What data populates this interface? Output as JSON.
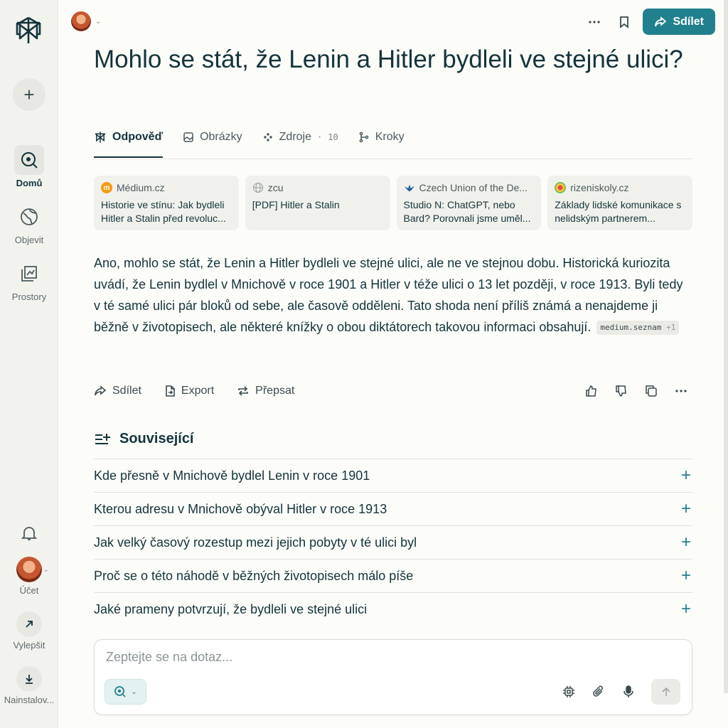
{
  "sidebar": {
    "new_thread": "+",
    "items": [
      {
        "label": "Domů",
        "icon": "search-icon",
        "active": true
      },
      {
        "label": "Objevit",
        "icon": "globe-icon",
        "active": false
      },
      {
        "label": "Prostory",
        "icon": "spaces-icon",
        "active": false
      }
    ],
    "account_label": "Účet",
    "upgrade_label": "Vylepšit",
    "install_label": "Nainstalov..."
  },
  "topbar": {
    "share_label": "Sdílet"
  },
  "page": {
    "title": "Mohlo se stát, že Lenin a Hitler bydleli ve stejné ulici?"
  },
  "tabs": [
    {
      "label": "Odpověď",
      "icon": "answer-icon",
      "active": true
    },
    {
      "label": "Obrázky",
      "icon": "image-icon",
      "active": false
    },
    {
      "label": "Zdroje",
      "icon": "sources-icon",
      "active": false,
      "count_sep": "·",
      "count": "10"
    },
    {
      "label": "Kroky",
      "icon": "steps-icon",
      "active": false
    }
  ],
  "sources": [
    {
      "site": "Médium.cz",
      "title": "Historie ve stínu: Jak bydleli Hitler a Stalin před revoluc...",
      "favicon_letter": "m",
      "favicon_color": "#f39c12"
    },
    {
      "site": "zcu",
      "title": "[PDF] Hitler a Stalin",
      "favicon_letter": "",
      "favicon_color": "#d7d7d2"
    },
    {
      "site": "Czech Union of the De...",
      "title": "Studio N: ChatGPT, nebo Bard? Porovnali jsme uměl...",
      "favicon_letter": "",
      "favicon_color": "#1f5fa8"
    },
    {
      "site": "rizeniskoly.cz",
      "title": "Základy lidské komunikace s nelidským partnerem...",
      "favicon_letter": "",
      "favicon_color": "#8fc14a"
    }
  ],
  "answer": {
    "text": "Ano, mohlo se stát, že Lenin a Hitler bydleli ve stejné ulici, ale ne ve stejnou dobu. Historická kuriozita uvádí, že Lenin bydlel v Mnichově v roce 1901 a Hitler v téže ulici o 13 let později, v roce 1913. Byli tedy v té samé ulici pár bloků od sebe, ale časově odděleni. Tato shoda není příliš známá a nenajdeme ji běžně v životopisech, ale některé knížky o obou diktátorech takovou informaci obsahují.",
    "citation": "medium.seznam",
    "citation_more": "+1"
  },
  "answer_actions": {
    "share": "Sdílet",
    "export": "Export",
    "rewrite": "Přepsat"
  },
  "related": {
    "heading": "Související",
    "items": [
      "Kde přesně v Mnichově bydlel Lenin v roce 1901",
      "Kterou adresu v Mnichově obýval Hitler v roce 1913",
      "Jak velký časový rozestup mezi jejich pobyty v té ulici byl",
      "Proč se o této náhodě v běžných životopisech málo píše",
      "Jaké prameny potvrzují, že bydleli ve stejné ulici"
    ]
  },
  "composer": {
    "placeholder": "Zeptejte se na dotaz..."
  },
  "colors": {
    "accent": "#21808d",
    "background": "#fcfcf9",
    "sidebar": "#f3f3ee"
  }
}
